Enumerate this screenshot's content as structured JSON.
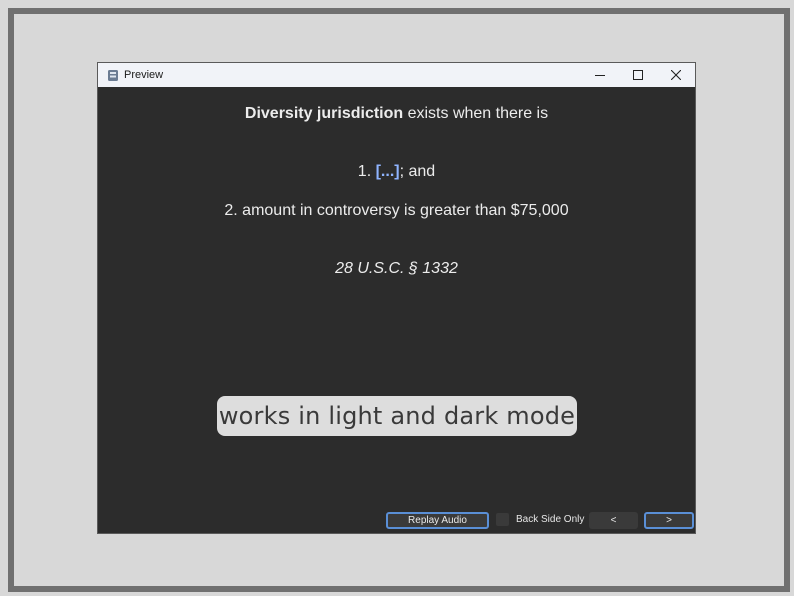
{
  "window": {
    "title": "Preview",
    "controls": {
      "minimize": "—",
      "maximize": "☐",
      "close": "✕"
    }
  },
  "card": {
    "line1_bold": "Diversity jurisdiction",
    "line1_rest": " exists when there is",
    "item1_prefix": "1. ",
    "item1_cloze": "[...]",
    "item1_suffix": "; and",
    "item2": "2. amount in controversy is greater than $75,000",
    "citation": "28 U.S.C. § 1332"
  },
  "caption": "works in light and dark mode",
  "bottom_bar": {
    "replay_audio": "Replay Audio",
    "back_side_only": "Back Side Only",
    "prev": "<",
    "next": ">"
  },
  "colors": {
    "card_background": "#2c2c2c",
    "cloze": "#8fb4ff",
    "focus_border": "#5a8fd6"
  }
}
